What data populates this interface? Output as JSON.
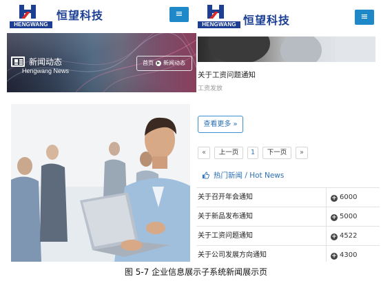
{
  "brand": {
    "logo_text": "HENGWANG",
    "name": "恒望科技",
    "menu_glyph": "≡"
  },
  "left": {
    "banner": {
      "title": "新闻动态",
      "subtitle": "Hengwang News",
      "crumb_home": "首页",
      "crumb_current": "新闻动态",
      "icon": "newspaper-icon"
    }
  },
  "right": {
    "news_title": "关于工资问题通知",
    "news_sub": "工资发放",
    "more_button": "查看更多 »",
    "pagination": {
      "first": "«",
      "prev": "上一页",
      "current": "1",
      "next": "下一页",
      "last": "»"
    },
    "hot": {
      "heading": "热门新闻 / Hot News",
      "icon": "thumbs-up-icon",
      "rows": [
        {
          "title": "关于召开年会通知",
          "count": "6000"
        },
        {
          "title": "关于新品发布通知",
          "count": "5000"
        },
        {
          "title": "关于工资问题通知",
          "count": "4522"
        },
        {
          "title": "关于公司发展方向通知",
          "count": "4300"
        }
      ]
    }
  },
  "caption": "图 5-7 企业信息展示子系统新闻展示页",
  "colors": {
    "brand_blue": "#1c3f94",
    "accent_blue": "#1e88c8",
    "link_blue": "#2a6fb5"
  }
}
